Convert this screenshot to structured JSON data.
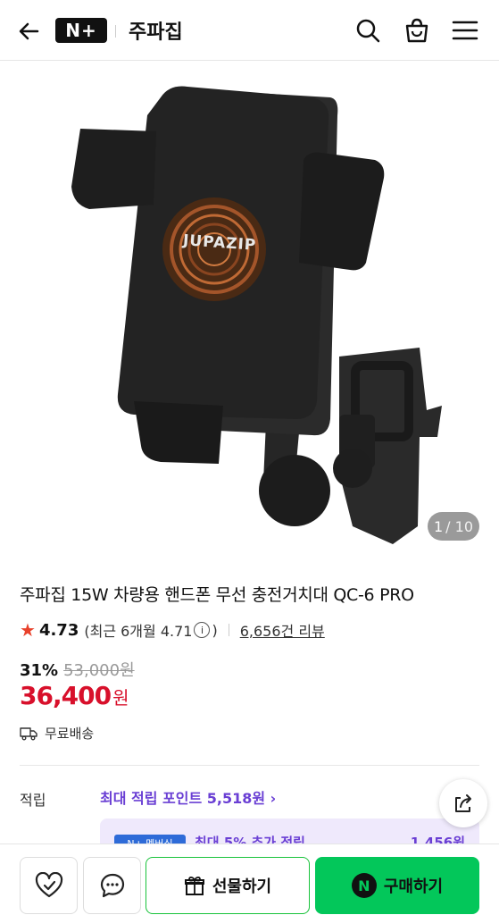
{
  "header": {
    "logo_text": "N+",
    "store_name": "주파집"
  },
  "hero": {
    "brand_mark": "JUPAZIP",
    "counter_current": "1",
    "counter_total": "/ 10"
  },
  "product": {
    "title": "주파집 15W 차량용 핸드폰 무선 충전거치대 QC-6 PRO",
    "rating": "4.73",
    "recent_rating": "(최근 6개월 4.71",
    "recent_rating_close": ")",
    "info_glyph": "i",
    "review_count": "6,656건 리뷰",
    "discount_pct": "31%",
    "original_price": "53,000원",
    "price": "36,400",
    "price_unit": "원",
    "shipping": "무료배송"
  },
  "points": {
    "label": "적립",
    "max_points": "최대 적립 포인트 5,518원 ›",
    "promo_badge": "N+ 멤버십",
    "promo_text": "최대 5% 추가 적립",
    "promo_amount": "1,456원"
  },
  "bottom_bar": {
    "gift_label": "선물하기",
    "buy_label": "구매하기",
    "buy_logo": "N"
  },
  "colors": {
    "price_red": "#d8102b",
    "points_purple": "#6a3fd4",
    "naver_green": "#03c75a"
  }
}
